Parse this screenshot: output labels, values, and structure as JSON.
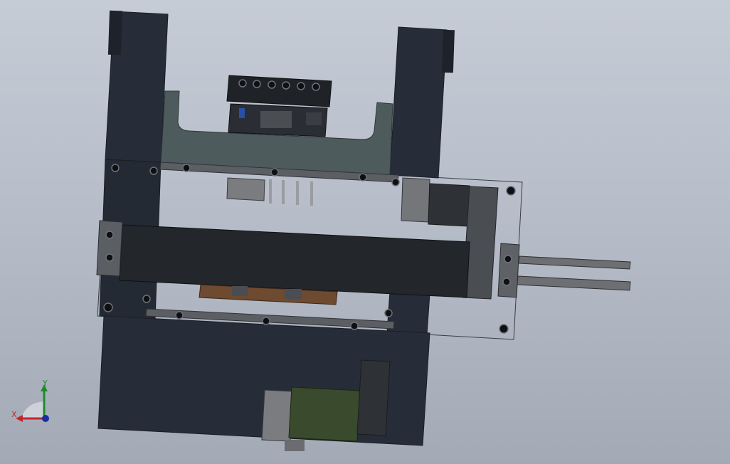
{
  "viewport": {
    "background_top": "#c6ccd6",
    "background_bottom": "#a3aab6"
  },
  "model": {
    "frame_color": "#262d38",
    "plate_color": "#4e5b5c",
    "slide_color": "#23262b",
    "motor_color": "#5c5d5f",
    "motor_green": "#3a4a2c",
    "bracket_color": "#6e4a30",
    "rail_color": "#6d6f73",
    "outline_color": "#3a3d42"
  },
  "triad": {
    "x_label": "X",
    "y_label": "Y",
    "x_color": "#c0272d",
    "y_color": "#1f8b2d",
    "z_color": "#1c2fa0"
  }
}
